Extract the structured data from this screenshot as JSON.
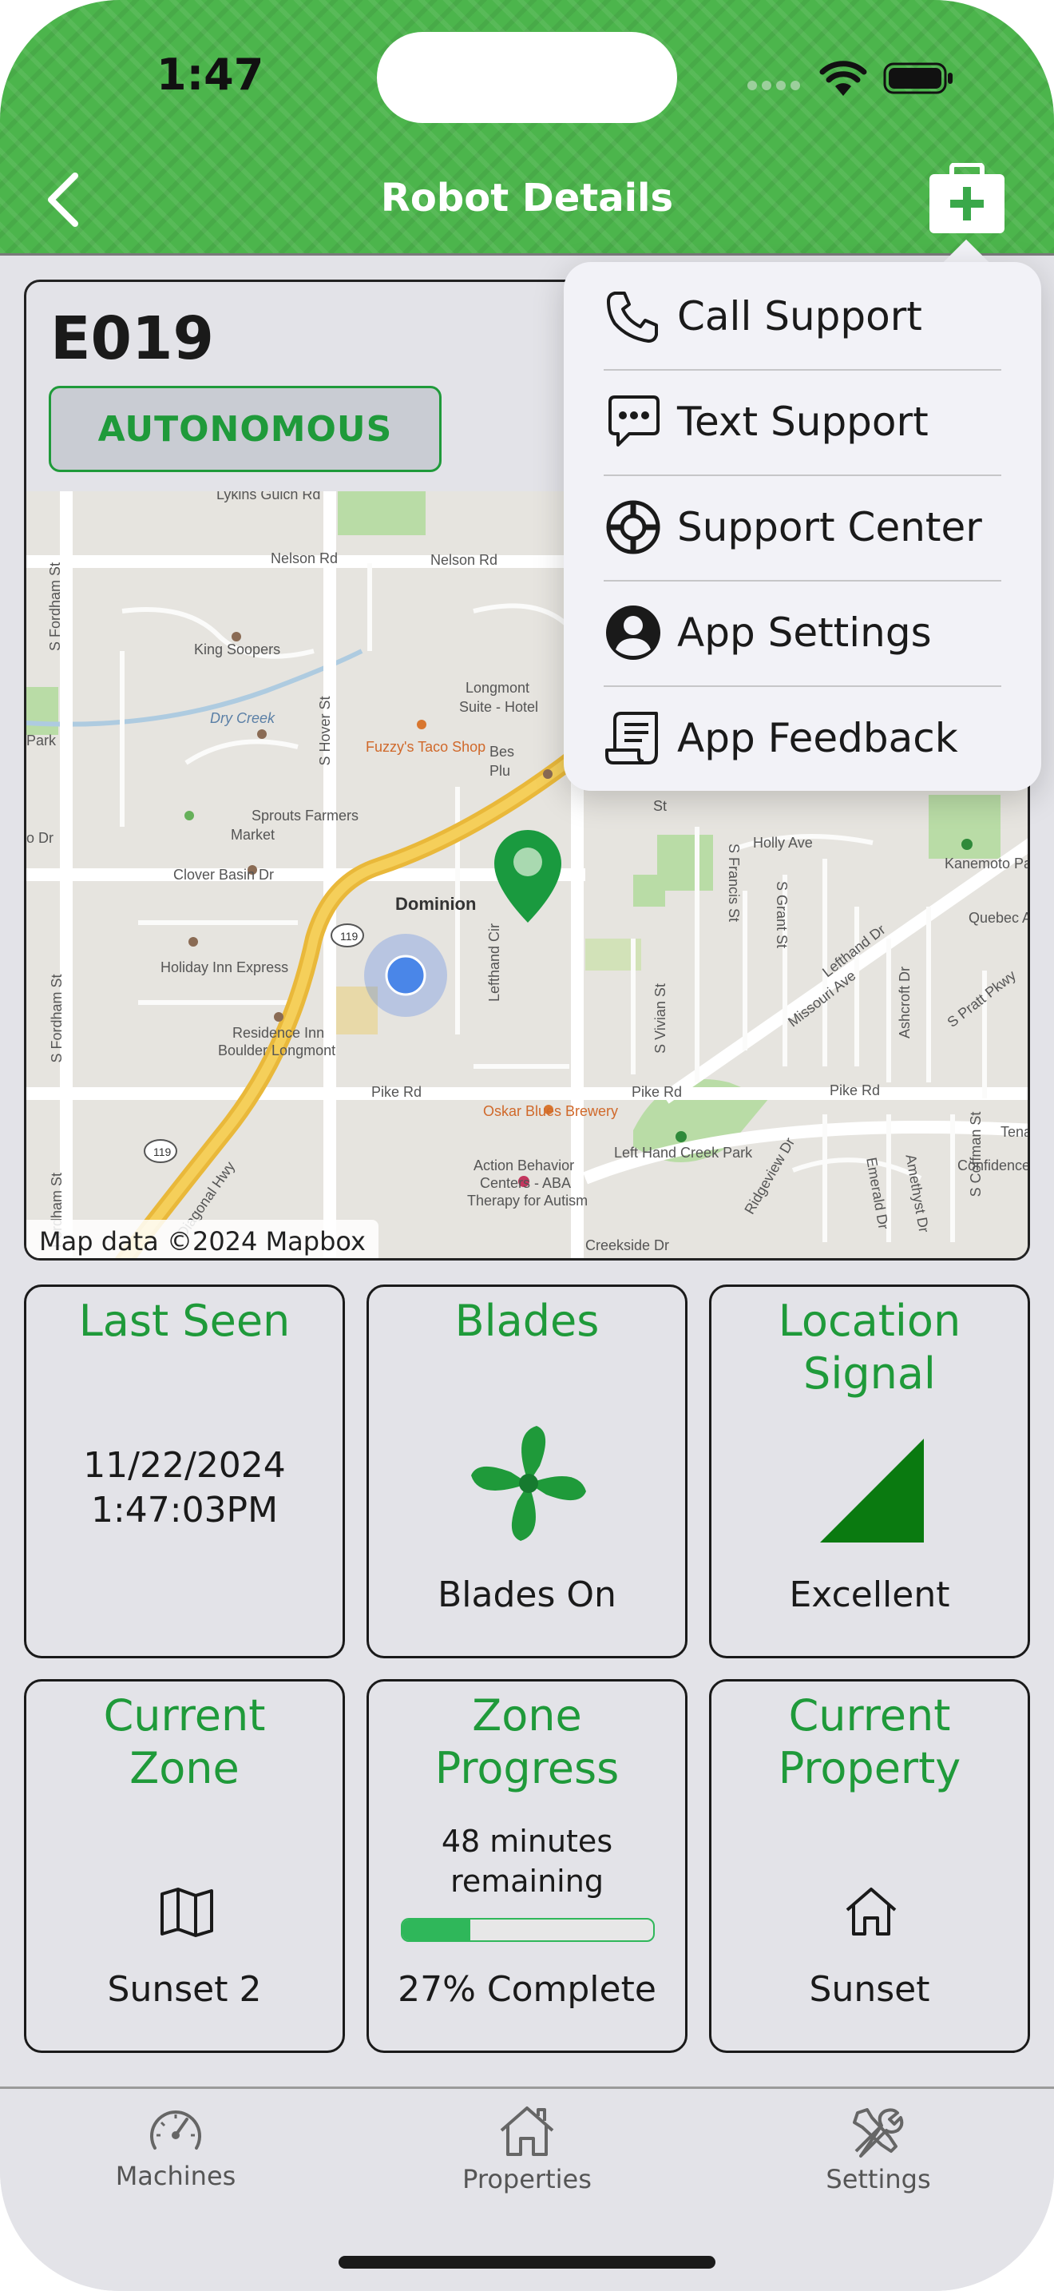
{
  "status_bar": {
    "time": "1:47"
  },
  "nav": {
    "title": "Robot Details"
  },
  "robot": {
    "name": "E019",
    "mode": "AUTONOMOUS"
  },
  "map": {
    "attribution": "Map data ©2024 Mapbox",
    "labels": {
      "lykins": "Lykins Gulch Rd",
      "nelson1": "Nelson Rd",
      "nelson2": "Nelson Rd",
      "king": "King Soopers",
      "drycreek": "Dry Creek",
      "park": "Park",
      "longmont": "Longmont",
      "suite": "Suite - Hotel",
      "fuzzy": "Fuzzy's Taco Shop",
      "best": "Bes",
      "plu": "Plu",
      "hover": "S Hover St",
      "fordham_top": "S Fordham St",
      "sprouts": "Sprouts Farmers",
      "market": "Market",
      "clover": "Clover Basin Dr",
      "odr": "o Dr",
      "dominion": "Dominion",
      "holiday": "Holiday Inn Express",
      "residence": "Residence Inn",
      "boulder": "Boulder Longmont",
      "lefthand_cir": "Lefthand Cir",
      "oskar": "Oskar Blues Brewery",
      "pike1": "Pike Rd",
      "pike2": "Pike Rd",
      "pike3": "Pike Rd",
      "fordham_mid": "S Fordham St",
      "fordham_bot": "Fordham St",
      "diagonal": "Diagonal Hwy",
      "action1": "Action Behavior",
      "action2": "Centers - ABA",
      "action3": "Therapy for Autism",
      "lefthand_park": "Left Hand Creek Park",
      "creekside": "Creekside Dr",
      "ridgeview": "Ridgeview Dr",
      "emerald": "Emerald Dr",
      "amethyst": "Amethyst Dr",
      "coffman": "S Coffman St",
      "confidence": "Confidence Dr",
      "tena": "Tenac",
      "holly": "Holly Ave",
      "francis": "S Francis St",
      "grant": "S Grant St",
      "vivian": "S Vivian St",
      "missouri": "Missouri Ave",
      "lefthand_dr": "Lefthand Dr",
      "ashcroft": "Ashcroft Dr",
      "pratt": "S Pratt Pkwy",
      "quebec": "Quebec Ave",
      "kanemoto": "Kanemoto Park",
      "st": "St",
      "route1": "119",
      "route2": "119"
    }
  },
  "support_menu": {
    "items": [
      {
        "label": "Call Support",
        "icon": "phone-icon"
      },
      {
        "label": "Text Support",
        "icon": "chat-bubble-icon"
      },
      {
        "label": "Support Center",
        "icon": "lifebuoy-icon"
      },
      {
        "label": "App Settings",
        "icon": "person-circle-icon"
      },
      {
        "label": "App Feedback",
        "icon": "receipt-scroll-icon"
      }
    ]
  },
  "tiles": {
    "last_seen": {
      "title": "Last Seen",
      "date": "11/22/2024",
      "time": "1:47:03PM"
    },
    "blades": {
      "title": "Blades",
      "status": "Blades On",
      "icon": "fan-icon"
    },
    "location_signal": {
      "title_line1": "Location",
      "title_line2": "Signal",
      "status": "Excellent",
      "icon": "signal-triangle-icon"
    },
    "current_zone": {
      "title_line1": "Current",
      "title_line2": "Zone",
      "value": "Sunset 2",
      "icon": "map-icon"
    },
    "zone_progress": {
      "title_line1": "Zone",
      "title_line2": "Progress",
      "remaining_line1": "48 minutes",
      "remaining_line2": "remaining",
      "percent": 27,
      "complete_text": "27% Complete"
    },
    "current_property": {
      "title_line1": "Current",
      "title_line2": "Property",
      "value": "Sunset",
      "icon": "house-icon"
    }
  },
  "tabbar": {
    "tabs": [
      {
        "label": "Machines",
        "icon": "speedometer-icon"
      },
      {
        "label": "Properties",
        "icon": "house-icon"
      },
      {
        "label": "Settings",
        "icon": "tools-icon"
      }
    ]
  },
  "colors": {
    "brand_green": "#4cb54c",
    "accent_green": "#1f9a3a",
    "progress_green": "#2fb75a",
    "location_blue": "#3b82f6"
  }
}
